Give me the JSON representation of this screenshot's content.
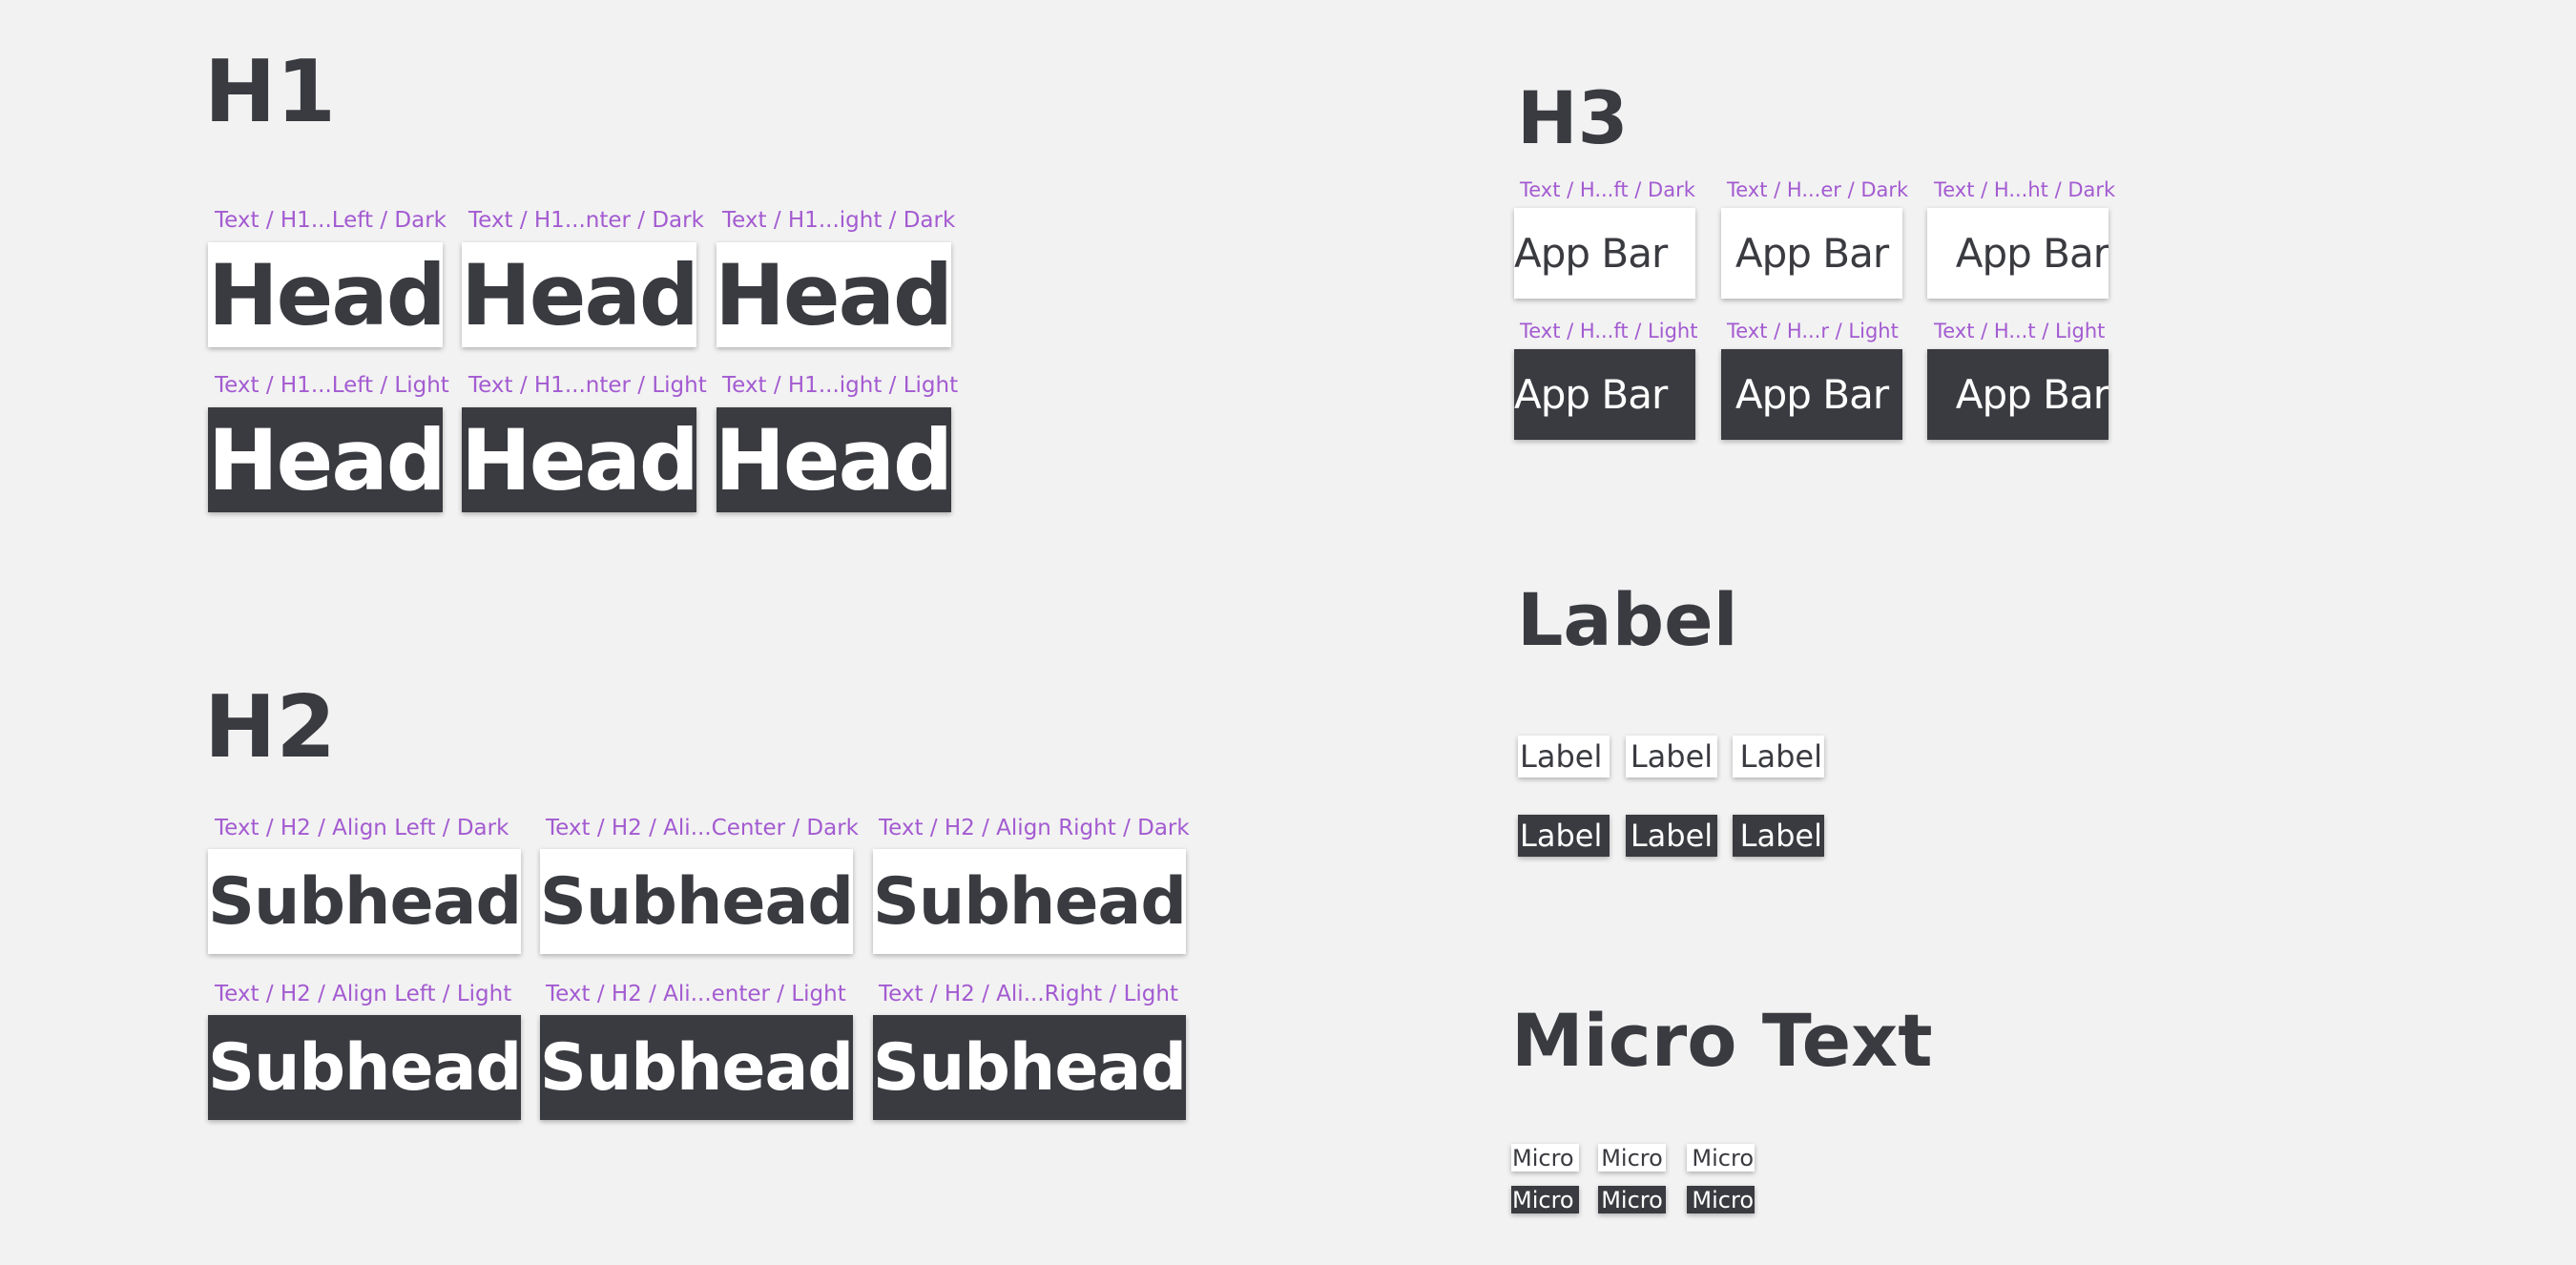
{
  "h1": {
    "title": "H1",
    "labels": [
      "Text / H1...Left / Dark",
      "Text / H1...nter / Dark",
      "Text / H1...ight / Dark",
      "Text / H1...Left / Light",
      "Text / H1...nter / Light",
      "Text / H1...ight / Light"
    ],
    "text": "Head"
  },
  "h2": {
    "title": "H2",
    "labels": [
      "Text / H2 / Align Left / Dark",
      "Text / H2 / Ali...Center / Dark",
      "Text / H2 / Align Right / Dark",
      "Text / H2 / Align Left / Light",
      "Text / H2 / Ali...enter / Light",
      "Text / H2 / Ali...Right / Light"
    ],
    "text": "Subhead"
  },
  "h3": {
    "title": "H3",
    "labels": [
      "Text / H...ft / Dark",
      "Text / H...er / Dark",
      "Text / H...ht / Dark",
      "Text / H...ft / Light",
      "Text / H...r / Light",
      "Text / H...t / Light"
    ],
    "text": "App Bar"
  },
  "label": {
    "title": "Label",
    "text": "Label"
  },
  "micro": {
    "title": "Micro Text",
    "text": "Micro"
  },
  "colors": {
    "background": "#f2f2f2",
    "dark_text": "#3a3b40",
    "annotation": "#a35bd1",
    "tile_light": "#ffffff",
    "tile_dark": "#3a3b40"
  }
}
